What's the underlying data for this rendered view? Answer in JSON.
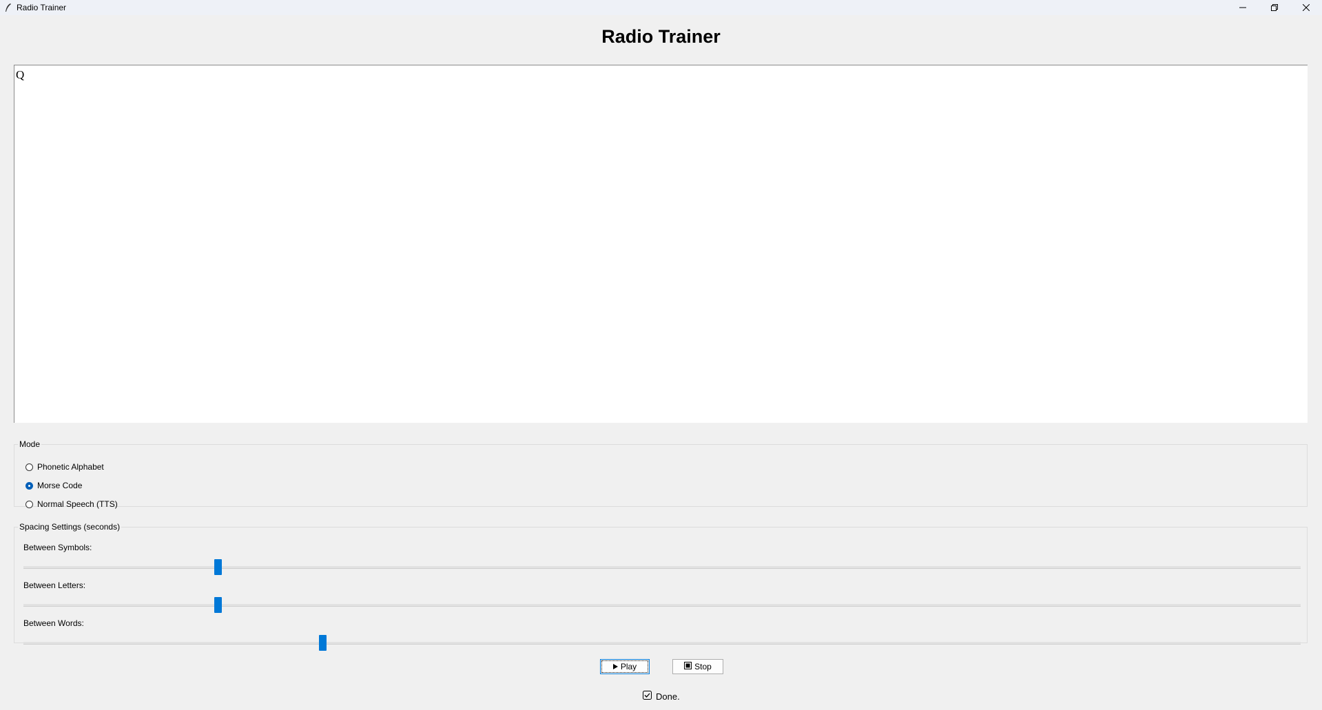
{
  "window": {
    "title": "Radio Trainer",
    "controls": [
      "minimize-icon",
      "restore-icon",
      "close-icon"
    ]
  },
  "header": {
    "title": "Radio Trainer"
  },
  "editor": {
    "value": "Q"
  },
  "mode": {
    "label": "Mode",
    "options": [
      {
        "label": "Phonetic Alphabet",
        "selected": false
      },
      {
        "label": "Morse Code",
        "selected": true
      },
      {
        "label": "Normal Speech (TTS)",
        "selected": false
      }
    ]
  },
  "spacing": {
    "label": "Spacing Settings (seconds)",
    "sliders": [
      {
        "label": "Between Symbols:",
        "fraction": 0.152
      },
      {
        "label": "Between Letters:",
        "fraction": 0.152
      },
      {
        "label": "Between Words:",
        "fraction": 0.234
      }
    ]
  },
  "controls": {
    "play_label": "Play",
    "play_icon": "play-icon",
    "stop_label": "Stop",
    "stop_icon": "stop-icon"
  },
  "status": {
    "text": "Done.",
    "icon": "checkbox-check-icon"
  },
  "colors": {
    "accent": "#0078d7",
    "background": "#f0f0f0",
    "titlebar": "#eef1f7"
  }
}
